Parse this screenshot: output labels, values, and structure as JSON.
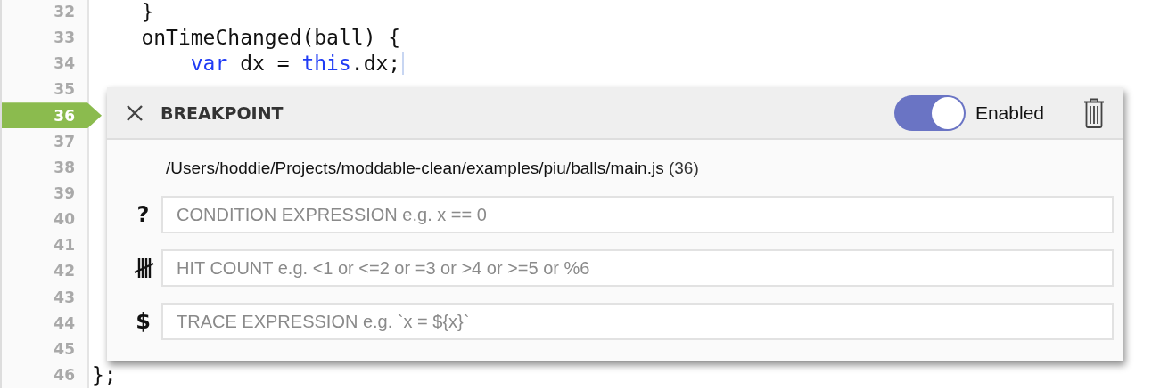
{
  "editor": {
    "lines": [
      {
        "number": "32",
        "breakpoint": false,
        "tokens": [
          {
            "text": "    }",
            "kind": "plain"
          }
        ]
      },
      {
        "number": "33",
        "breakpoint": false,
        "tokens": [
          {
            "text": "    onTimeChanged(ball) {",
            "kind": "plain"
          }
        ]
      },
      {
        "number": "34",
        "breakpoint": false,
        "cursor": true,
        "tokens": [
          {
            "text": "        var",
            "kind": "keyword"
          },
          {
            "text": " dx = ",
            "kind": "plain"
          },
          {
            "text": "this",
            "kind": "keyword"
          },
          {
            "text": ".dx;",
            "kind": "plain"
          }
        ]
      },
      {
        "number": "35",
        "breakpoint": false
      },
      {
        "number": "36",
        "breakpoint": true
      },
      {
        "number": "37",
        "breakpoint": false
      },
      {
        "number": "38",
        "breakpoint": false
      },
      {
        "number": "39",
        "breakpoint": false
      },
      {
        "number": "40",
        "breakpoint": false
      },
      {
        "number": "41",
        "breakpoint": false
      },
      {
        "number": "42",
        "breakpoint": false
      },
      {
        "number": "43",
        "breakpoint": false
      },
      {
        "number": "44",
        "breakpoint": false
      },
      {
        "number": "45",
        "breakpoint": false
      },
      {
        "number": "46",
        "breakpoint": false,
        "tokens": [
          {
            "text": "};",
            "kind": "plain"
          }
        ]
      }
    ]
  },
  "breakpoint_panel": {
    "title": "BREAKPOINT",
    "enabled": {
      "on": true,
      "label": "Enabled"
    },
    "file_path": "/Users/hoddie/Projects/moddable-clean/examples/piu/balls/main.js",
    "line_ref": "(36)",
    "fields": [
      {
        "kind": "condition",
        "symbol": "?",
        "placeholder": "CONDITION EXPRESSION e.g. x == 0"
      },
      {
        "kind": "hit_count",
        "placeholder": "HIT COUNT e.g. <1 or <=2 or =3 or >4 or >=5 or %6"
      },
      {
        "kind": "trace",
        "symbol": "$",
        "placeholder": "TRACE EXPRESSION e.g. `x = ${x}`"
      }
    ]
  }
}
